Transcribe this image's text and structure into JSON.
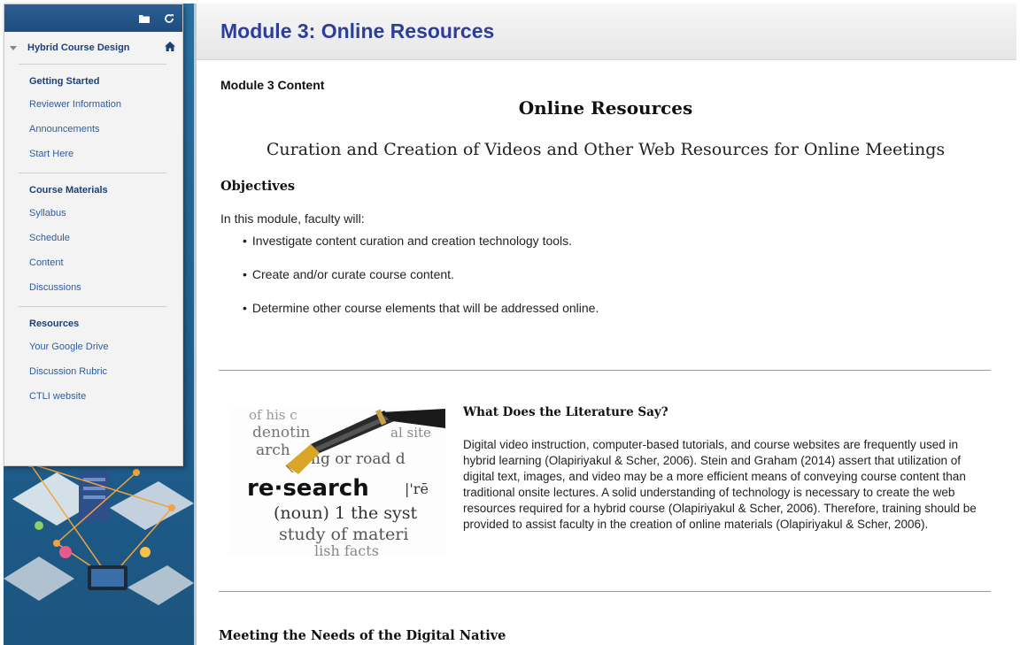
{
  "menu": {
    "course_title": "Hybrid Course Design",
    "sections": [
      {
        "heading": "Getting Started",
        "items": [
          "Reviewer Information",
          "Announcements",
          "Start Here"
        ]
      },
      {
        "heading": "Course Materials",
        "items": [
          "Syllabus",
          "Schedule",
          "Content",
          "Discussions"
        ]
      },
      {
        "heading": "Resources",
        "items": [
          "Your Google Drive",
          "Discussion Rubric",
          "CTLI website"
        ]
      }
    ]
  },
  "page": {
    "title": "Module 3: Online Resources",
    "content_label": "Module 3 Content",
    "heading_main": "Online Resources",
    "heading_sub": "Curation and Creation of Videos and Other Web Resources for Online Meetings",
    "objectives_heading": "Objectives",
    "intro": "In this module, faculty will:",
    "objectives": [
      "Investigate content curation and creation technology tools.",
      "Create and/or curate course content.",
      "Determine other course elements that will be addressed online."
    ],
    "literature": {
      "title": "What Does the Literature Say?",
      "body": "Digital video instruction, computer-based tutorials, and course websites are frequently used in hybrid learning (Olapiriyakul & Scher, 2006). Stein and Graham (2014) assert that utilization of digital text, images, and video may be a more efficient means of conveying course content than traditional onsite lectures. A solid understanding of technology is necessary to create the web resources required for a hybrid course (Olapiriyakul & Scher, 2006). Therefore, training should be provided to assist faculty in the creation of online materials (Olapiriyakul & Scher, 2006)."
    },
    "next_heading": "Meeting the Needs of the Digital Native"
  },
  "image_text": {
    "line1": "of his c",
    "line2": "denotin",
    "line3": "al site",
    "line4": "arch",
    "line5": "ng or road d",
    "word": "re·search",
    "pron": "|'rē",
    "line6": "(noun) 1 the syst",
    "line7": "study of materi",
    "line8": "lish facts"
  },
  "colors": {
    "accent": "#2c3e99",
    "link": "#2c5da3",
    "menu_header": "#1f4c7c"
  }
}
